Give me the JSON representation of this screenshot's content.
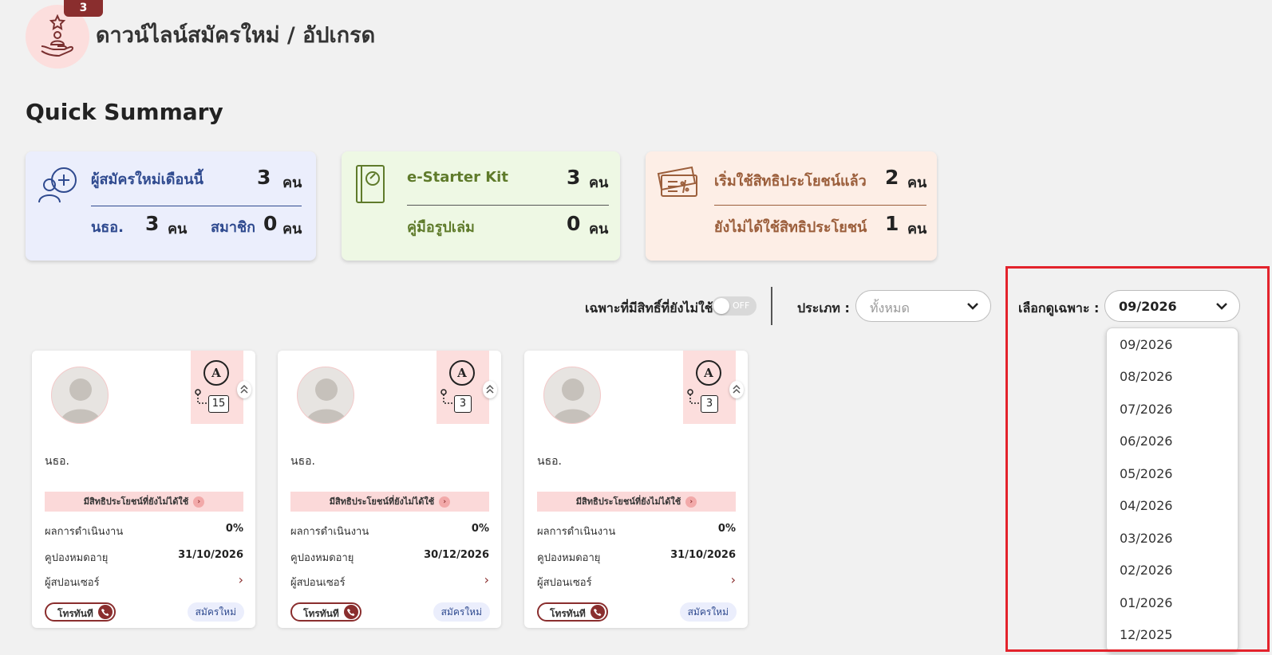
{
  "header": {
    "badge_count": "3",
    "title": "ดาวน์ไลน์สมัครใหม่ / อัปเกรด",
    "icon": "hand-star-person-icon"
  },
  "quick_summary": {
    "title": "Quick Summary",
    "new_members": {
      "label": "ผู้สมัครใหม่เดือนนี้",
      "value": "3",
      "unit": "คน",
      "sub1_label": "นธอ.",
      "sub1_value": "3",
      "sub1_unit": "คน",
      "sub2_label": "สมาชิก",
      "sub2_value": "0",
      "sub2_unit": "คน",
      "color": "#2f4a8f"
    },
    "starter": {
      "label": "e-Starter Kit",
      "value": "3",
      "unit": "คน",
      "sub_label": "คู่มือรูปเล่ม",
      "sub_value": "0",
      "sub_unit": "คน",
      "color": "#5f7b2b"
    },
    "benefits": {
      "label": "เริ่มใช้สิทธิประโยชน์แล้ว",
      "value": "2",
      "unit": "คน",
      "sub_label": "ยังไม่ได้ใช้สิทธิประโยชน์",
      "sub_value": "1",
      "sub_unit": "คน",
      "color": "#9b5e3b"
    }
  },
  "filters": {
    "toggle_label": "เฉพาะที่มีสิทธิ์ที่ยังไม่ใช้",
    "toggle_state": "OFF",
    "type_label": "ประเภท :",
    "type_value": "ทั้งหมด",
    "month_label": "เลือกดูเฉพาะ :",
    "month_value": "09/2026",
    "month_options": [
      "09/2026",
      "08/2026",
      "07/2026",
      "06/2026",
      "05/2026",
      "04/2026",
      "03/2026",
      "02/2026",
      "01/2026",
      "12/2025"
    ]
  },
  "cards": [
    {
      "grade": "A",
      "level": "15",
      "role": "นธอ.",
      "alert": "มีสิทธิประโยชน์ที่ยังไม่ได้ใช้",
      "perf_label": "ผลการดำเนินงาน",
      "perf_value": "0%",
      "coupon_label": "คูปองหมดอายุ",
      "coupon_value": "31/10/2026",
      "sponsor_label": "ผู้สปอนเซอร์",
      "call_label": "โทรทันที",
      "status": "สมัครใหม่"
    },
    {
      "grade": "A",
      "level": "3",
      "role": "นธอ.",
      "alert": "มีสิทธิประโยชน์ที่ยังไม่ได้ใช้",
      "perf_label": "ผลการดำเนินงาน",
      "perf_value": "0%",
      "coupon_label": "คูปองหมดอายุ",
      "coupon_value": "30/12/2026",
      "sponsor_label": "ผู้สปอนเซอร์",
      "call_label": "โทรทันที",
      "status": "สมัครใหม่"
    },
    {
      "grade": "A",
      "level": "3",
      "role": "นธอ.",
      "alert": "มีสิทธิประโยชน์ที่ยังไม่ได้ใช้",
      "perf_label": "ผลการดำเนินงาน",
      "perf_value": "0%",
      "coupon_label": "คูปองหมดอายุ",
      "coupon_value": "31/10/2026",
      "sponsor_label": "ผู้สปอนเซอร์",
      "call_label": "โทรทันที",
      "status": "สมัครใหม่"
    }
  ],
  "colors": {
    "accent": "#8a2e2e",
    "highlight_border": "#e3232c"
  }
}
